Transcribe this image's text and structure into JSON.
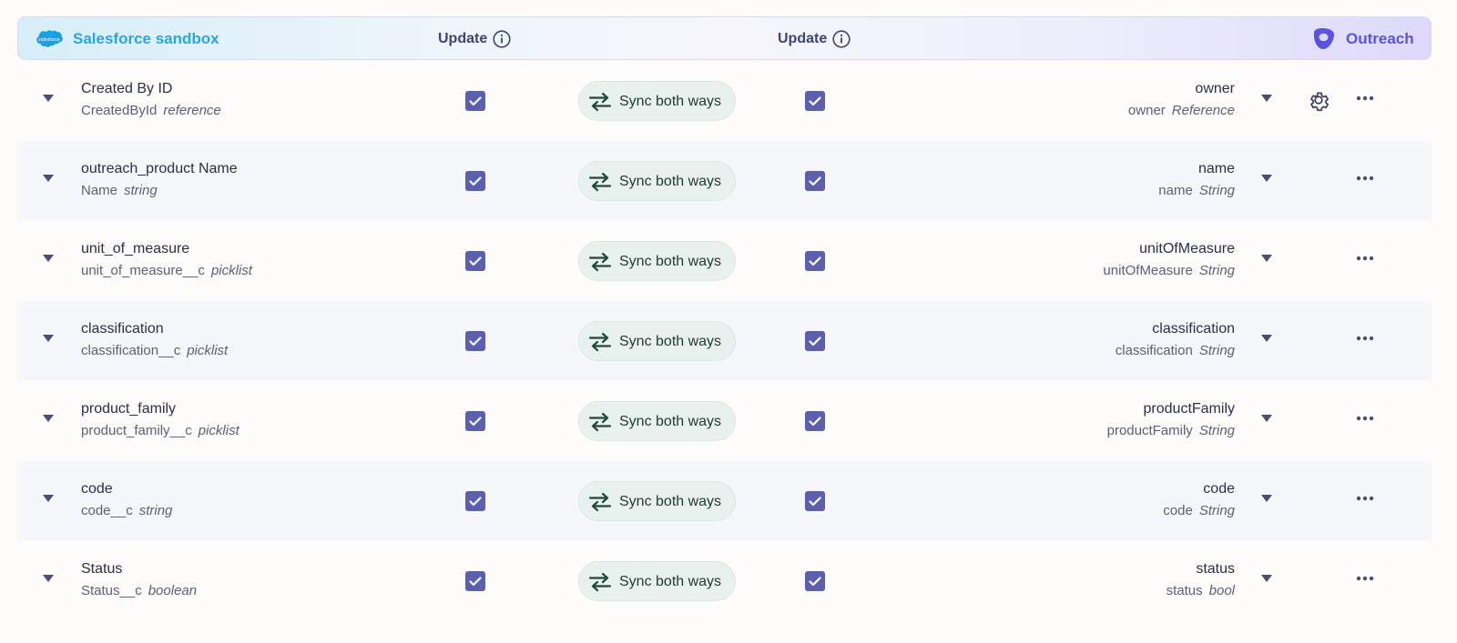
{
  "header": {
    "source_name": "Salesforce sandbox",
    "source_logo_text": "salesforce",
    "update_label_left": "Update",
    "update_label_right": "Update",
    "target_name": "Outreach"
  },
  "colors": {
    "checkbox": "#5c5fae",
    "sync_pill_bg": "#e8f1ee",
    "salesforce_blue": "#2aa7dc",
    "outreach_purple": "#5b52e0"
  },
  "rows": [
    {
      "src_label": "Created By ID",
      "src_api": "CreatedById",
      "src_type": "reference",
      "update_left": true,
      "sync_label": "Sync both ways",
      "update_right": true,
      "dst_label": "owner",
      "dst_api": "owner",
      "dst_type": "Reference",
      "has_settings": true
    },
    {
      "src_label": "outreach_product Name",
      "src_api": "Name",
      "src_type": "string",
      "update_left": true,
      "sync_label": "Sync both ways",
      "update_right": true,
      "dst_label": "name",
      "dst_api": "name",
      "dst_type": "String",
      "has_settings": false
    },
    {
      "src_label": "unit_of_measure",
      "src_api": "unit_of_measure__c",
      "src_type": "picklist",
      "update_left": true,
      "sync_label": "Sync both ways",
      "update_right": true,
      "dst_label": "unitOfMeasure",
      "dst_api": "unitOfMeasure",
      "dst_type": "String",
      "has_settings": false
    },
    {
      "src_label": "classification",
      "src_api": "classification__c",
      "src_type": "picklist",
      "update_left": true,
      "sync_label": "Sync both ways",
      "update_right": true,
      "dst_label": "classification",
      "dst_api": "classification",
      "dst_type": "String",
      "has_settings": false
    },
    {
      "src_label": "product_family",
      "src_api": "product_family__c",
      "src_type": "picklist",
      "update_left": true,
      "sync_label": "Sync both ways",
      "update_right": true,
      "dst_label": "productFamily",
      "dst_api": "productFamily",
      "dst_type": "String",
      "has_settings": false
    },
    {
      "src_label": "code",
      "src_api": "code__c",
      "src_type": "string",
      "update_left": true,
      "sync_label": "Sync both ways",
      "update_right": true,
      "dst_label": "code",
      "dst_api": "code",
      "dst_type": "String",
      "has_settings": false
    },
    {
      "src_label": "Status",
      "src_api": "Status__c",
      "src_type": "boolean",
      "update_left": true,
      "sync_label": "Sync both ways",
      "update_right": true,
      "dst_label": "status",
      "dst_api": "status",
      "dst_type": "bool",
      "has_settings": false
    }
  ]
}
